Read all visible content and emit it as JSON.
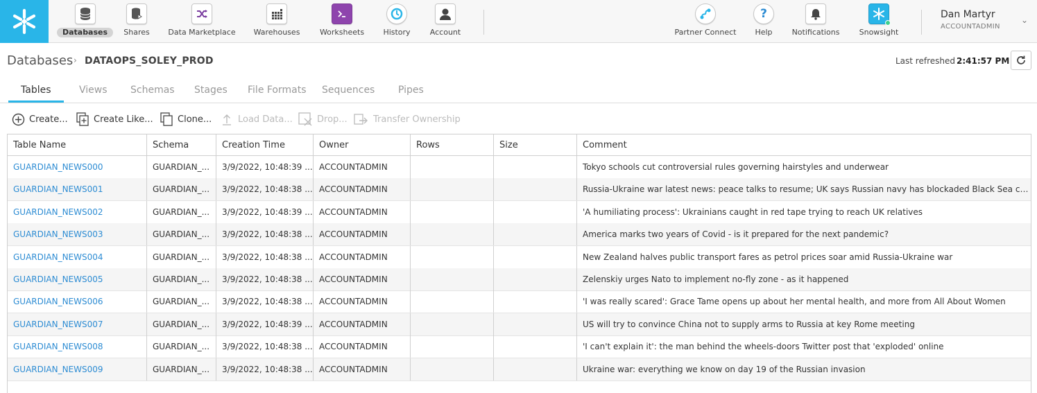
{
  "nav": {
    "items": [
      {
        "label": "Databases",
        "icon": "database-icon"
      },
      {
        "label": "Shares",
        "icon": "share-icon"
      },
      {
        "label": "Data Marketplace",
        "icon": "marketplace-icon"
      },
      {
        "label": "Warehouses",
        "icon": "warehouse-icon"
      },
      {
        "label": "Worksheets",
        "icon": "terminal-icon"
      },
      {
        "label": "History",
        "icon": "history-icon"
      },
      {
        "label": "Account",
        "icon": "account-icon"
      }
    ],
    "right_items": [
      {
        "label": "Partner Connect",
        "icon": "partner-connect-icon"
      },
      {
        "label": "Help",
        "icon": "help-icon"
      },
      {
        "label": "Notifications",
        "icon": "bell-icon"
      },
      {
        "label": "Snowsight",
        "icon": "snowsight-icon"
      }
    ],
    "active": "Databases",
    "brand_color": "#29b5e8"
  },
  "user": {
    "name": "Dan Martyr",
    "role": "ACCOUNTADMIN"
  },
  "breadcrumb": {
    "root": "Databases",
    "separator": "›",
    "database": "DATAOPS_SOLEY_PROD"
  },
  "refresh": {
    "label": "Last refreshed",
    "time": "2:41:57 PM"
  },
  "tabs": [
    "Tables",
    "Views",
    "Schemas",
    "Stages",
    "File Formats",
    "Sequences",
    "Pipes"
  ],
  "active_tab": "Tables",
  "toolbar": {
    "create": "Create...",
    "create_like": "Create Like...",
    "clone": "Clone...",
    "load_data": "Load Data...",
    "drop": "Drop...",
    "transfer": "Transfer Ownership"
  },
  "table": {
    "columns": [
      "Table Name",
      "Schema",
      "Creation Time",
      "Owner",
      "Rows",
      "Size",
      "Comment"
    ],
    "rows": [
      {
        "name": "GUARDIAN_NEWS000",
        "schema": "GUARDIAN_...",
        "created": "3/9/2022, 10:48:39 ...",
        "owner": "ACCOUNTADMIN",
        "rows": "",
        "size": "",
        "comment": "Tokyo schools cut controversial rules governing hairstyles and underwear"
      },
      {
        "name": "GUARDIAN_NEWS001",
        "schema": "GUARDIAN_...",
        "created": "3/9/2022, 10:48:38 ...",
        "owner": "ACCOUNTADMIN",
        "rows": "",
        "size": "",
        "comment": "Russia-Ukraine war latest news: peace talks to resume; UK says Russian navy has blockaded Black Sea coast -..."
      },
      {
        "name": "GUARDIAN_NEWS002",
        "schema": "GUARDIAN_...",
        "created": "3/9/2022, 10:48:39 ...",
        "owner": "ACCOUNTADMIN",
        "rows": "",
        "size": "",
        "comment": "'A humiliating process': Ukrainians caught in red tape trying to reach UK relatives"
      },
      {
        "name": "GUARDIAN_NEWS003",
        "schema": "GUARDIAN_...",
        "created": "3/9/2022, 10:48:38 ...",
        "owner": "ACCOUNTADMIN",
        "rows": "",
        "size": "",
        "comment": "America marks two years of Covid - is it prepared for the next pandemic?"
      },
      {
        "name": "GUARDIAN_NEWS004",
        "schema": "GUARDIAN_...",
        "created": "3/9/2022, 10:48:38 ...",
        "owner": "ACCOUNTADMIN",
        "rows": "",
        "size": "",
        "comment": "New Zealand halves public transport fares as petrol prices soar amid Russia-Ukraine war"
      },
      {
        "name": "GUARDIAN_NEWS005",
        "schema": "GUARDIAN_...",
        "created": "3/9/2022, 10:48:38 ...",
        "owner": "ACCOUNTADMIN",
        "rows": "",
        "size": "",
        "comment": "Zelenskiy urges Nato to implement no-fly zone - as it happened"
      },
      {
        "name": "GUARDIAN_NEWS006",
        "schema": "GUARDIAN_...",
        "created": "3/9/2022, 10:48:38 ...",
        "owner": "ACCOUNTADMIN",
        "rows": "",
        "size": "",
        "comment": "'I was really scared': Grace Tame opens up about her mental health, and more from All About Women"
      },
      {
        "name": "GUARDIAN_NEWS007",
        "schema": "GUARDIAN_...",
        "created": "3/9/2022, 10:48:39 ...",
        "owner": "ACCOUNTADMIN",
        "rows": "",
        "size": "",
        "comment": "US will try to convince China not to supply arms to Russia at key Rome meeting"
      },
      {
        "name": "GUARDIAN_NEWS008",
        "schema": "GUARDIAN_...",
        "created": "3/9/2022, 10:48:38 ...",
        "owner": "ACCOUNTADMIN",
        "rows": "",
        "size": "",
        "comment": "'I can't explain it': the man behind the wheels-doors Twitter post that 'exploded' online"
      },
      {
        "name": "GUARDIAN_NEWS009",
        "schema": "GUARDIAN_...",
        "created": "3/9/2022, 10:48:38 ...",
        "owner": "ACCOUNTADMIN",
        "rows": "",
        "size": "",
        "comment": "Ukraine war: everything we know on day 19 of the Russian invasion"
      }
    ]
  }
}
